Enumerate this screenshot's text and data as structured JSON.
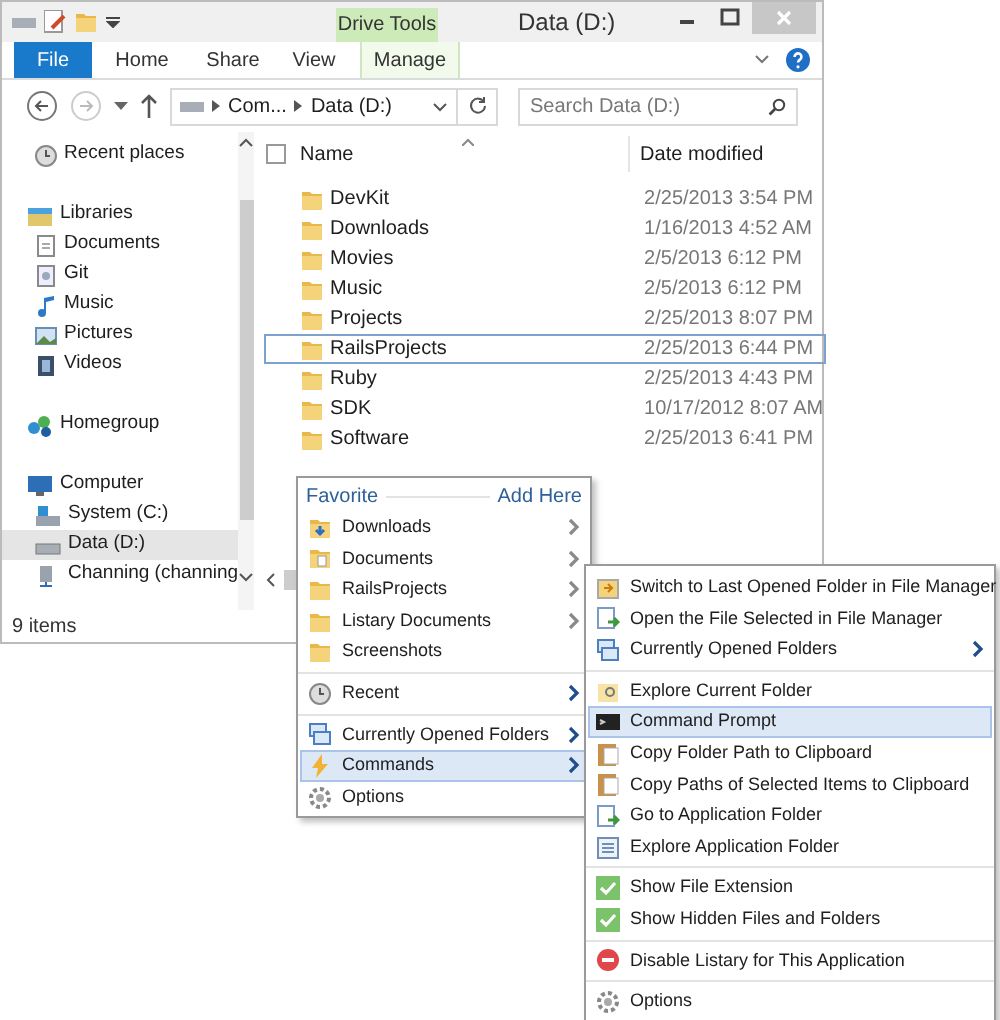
{
  "window": {
    "title": "Data (D:)",
    "context_tab": "Drive Tools"
  },
  "ribbon_tabs": [
    {
      "label": "File",
      "kind": "file"
    },
    {
      "label": "Home",
      "kind": "tab"
    },
    {
      "label": "Share",
      "kind": "tab"
    },
    {
      "label": "View",
      "kind": "tab"
    },
    {
      "label": "Manage",
      "kind": "context"
    }
  ],
  "address": {
    "path": [
      "Com...",
      "Data (D:)"
    ]
  },
  "search": {
    "placeholder": "Search Data (D:)"
  },
  "nav": [
    {
      "label": "Recent places",
      "kind": "recent",
      "selected": false
    },
    {
      "label": "Libraries",
      "kind": "libraries",
      "selected": false,
      "children": [
        {
          "label": "Documents",
          "kind": "document",
          "selected": false
        },
        {
          "label": "Git",
          "kind": "git",
          "selected": false
        },
        {
          "label": "Music",
          "kind": "music",
          "selected": false
        },
        {
          "label": "Pictures",
          "kind": "pictures",
          "selected": false
        },
        {
          "label": "Videos",
          "kind": "videos",
          "selected": false
        }
      ]
    },
    {
      "label": "Homegroup",
      "kind": "homegroup",
      "selected": false
    },
    {
      "label": "Computer",
      "kind": "computer",
      "selected": false,
      "children": [
        {
          "label": "System (C:)",
          "kind": "system",
          "selected": false
        },
        {
          "label": "Data (D:)",
          "kind": "drive",
          "selected": true
        },
        {
          "label": "Channing (channing",
          "kind": "network",
          "selected": false
        }
      ]
    }
  ],
  "select_all_checked": false,
  "columns": [
    "Name",
    "Date modified"
  ],
  "rows": [
    {
      "name": "DevKit",
      "date": "2/25/2013 3:54 PM",
      "focused": false
    },
    {
      "name": "Downloads",
      "date": "1/16/2013 4:52 AM",
      "focused": false
    },
    {
      "name": "Movies",
      "date": "2/5/2013 6:12 PM",
      "focused": false
    },
    {
      "name": "Music",
      "date": "2/5/2013 6:12 PM",
      "focused": false
    },
    {
      "name": "Projects",
      "date": "2/25/2013 8:07 PM",
      "focused": false
    },
    {
      "name": "RailsProjects",
      "date": "2/25/2013 6:44 PM",
      "focused": true
    },
    {
      "name": "Ruby",
      "date": "2/25/2013 4:43 PM",
      "focused": false
    },
    {
      "name": "SDK",
      "date": "10/17/2012 8:07 AM",
      "focused": false
    },
    {
      "name": "Software",
      "date": "2/25/2013 6:41 PM",
      "focused": false
    }
  ],
  "status_bar": "9 items",
  "favorite_menu": {
    "title": "Favorite",
    "action": "Add Here",
    "sections": [
      [
        {
          "label": "Downloads",
          "kind": "folder-download",
          "submenu": true,
          "selected": false
        },
        {
          "label": "Documents",
          "kind": "folder-doc",
          "submenu": true,
          "selected": false
        },
        {
          "label": "RailsProjects",
          "kind": "folder",
          "submenu": true,
          "selected": false
        },
        {
          "label": "Listary Documents",
          "kind": "folder",
          "submenu": true,
          "selected": false
        },
        {
          "label": "Screenshots",
          "kind": "folder",
          "submenu": false,
          "selected": false
        }
      ],
      [
        {
          "label": "Recent",
          "kind": "recent",
          "submenu": true,
          "selected": false
        }
      ],
      [
        {
          "label": "Currently Opened Folders",
          "kind": "windows",
          "submenu": true,
          "selected": false
        },
        {
          "label": "Commands",
          "kind": "lightning",
          "submenu": true,
          "selected": true
        },
        {
          "label": "Options",
          "kind": "gear",
          "submenu": false,
          "selected": false
        }
      ]
    ]
  },
  "commands_menu": {
    "sections": [
      [
        {
          "label": "Switch to Last Opened Folder in File Manager",
          "kind": "switch",
          "submenu": false,
          "selected": false
        },
        {
          "label": "Open the File Selected in File Manager",
          "kind": "open-file",
          "submenu": false,
          "selected": false
        },
        {
          "label": "Currently Opened Folders",
          "kind": "windows",
          "submenu": true,
          "selected": false
        }
      ],
      [
        {
          "label": "Explore Current Folder",
          "kind": "explore",
          "submenu": false,
          "selected": false
        },
        {
          "label": "Command Prompt",
          "kind": "console",
          "submenu": false,
          "selected": true
        },
        {
          "label": "Copy Folder Path to Clipboard",
          "kind": "clipboard",
          "submenu": false,
          "selected": false
        },
        {
          "label": "Copy Paths of Selected Items to Clipboard",
          "kind": "clipboard",
          "submenu": false,
          "selected": false
        },
        {
          "label": "Go to Application Folder",
          "kind": "open-file",
          "submenu": false,
          "selected": false
        },
        {
          "label": "Explore Application Folder",
          "kind": "explore-app",
          "submenu": false,
          "selected": false
        }
      ],
      [
        {
          "label": "Show File Extension",
          "kind": "check",
          "submenu": false,
          "selected": false
        },
        {
          "label": "Show Hidden Files and Folders",
          "kind": "check",
          "submenu": false,
          "selected": false
        }
      ],
      [
        {
          "label": "Disable Listary for This Application",
          "kind": "disable",
          "submenu": false,
          "selected": false
        }
      ],
      [
        {
          "label": "Options",
          "kind": "gear",
          "submenu": false,
          "selected": false
        }
      ]
    ]
  }
}
